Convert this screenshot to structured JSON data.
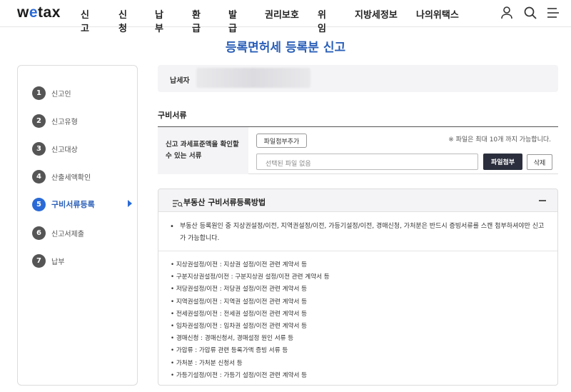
{
  "header": {
    "logo": "wetax",
    "nav": [
      "신고",
      "신청",
      "납부",
      "환급",
      "발급",
      "권리보호",
      "위임",
      "지방세정보",
      "나의위택스"
    ],
    "icons": [
      "user-icon",
      "search-icon",
      "menu-icon"
    ]
  },
  "page": {
    "title": "등록면허세 등록분 신고"
  },
  "sidebar": {
    "steps": [
      {
        "num": "1",
        "label": "신고인"
      },
      {
        "num": "2",
        "label": "신고유형"
      },
      {
        "num": "3",
        "label": "신고대상"
      },
      {
        "num": "4",
        "label": "산출세액확인"
      },
      {
        "num": "5",
        "label": "구비서류등록"
      },
      {
        "num": "6",
        "label": "신고서제출"
      },
      {
        "num": "7",
        "label": "납부"
      }
    ],
    "active_step": 5
  },
  "taxpayer": {
    "label": "납세자"
  },
  "documents": {
    "section_title": "구비서류",
    "row_label": "신고 과세표준액을 확인할 수 있는 서류",
    "add_button": "파일첨부추가",
    "note": "※ 파일은 최대 10개 까지 가능합니다.",
    "file_placeholder": "선택된 파일 없음",
    "attach_button": "파일첨부",
    "delete_button": "삭제"
  },
  "guide": {
    "title": "부동산 구비서류등록방법",
    "intro": "부동산 등록원인 중 지상권설정/이전, 지역권설정/이전, 가등기설정/이전, 경매신청, 가처분은 반드시 증빙서류를 스캔 첨부하셔야만 신고가 가능합니다.",
    "items": [
      "지상권설정/이전 : 지상권 설정/이전 관련 계약서 등",
      "구분지상권설정/이전 : 구분지상권 설정/이전 관련 계약서 등",
      "저당권설정/이전 : 저당권 설정/이전 관련 계약서 등",
      "지역권설정/이전 : 지역권 설정/이전 관련 계약서 등",
      "전세권설정/이전 : 전세권 설정/이전 관련 계약서 등",
      "임차권설정/이전 : 임차권 설정/이전 관련 계약서 등",
      "경매신청 : 경매신청서, 경매설정 원인 서류 등",
      "가압류 : 가압류 관련 등록가액 증빙 서류 등",
      "가처분 : 가처분 신청서 등",
      "가등기설정/이전 : 가등기 설정/이전 관련 계약서 등"
    ]
  }
}
